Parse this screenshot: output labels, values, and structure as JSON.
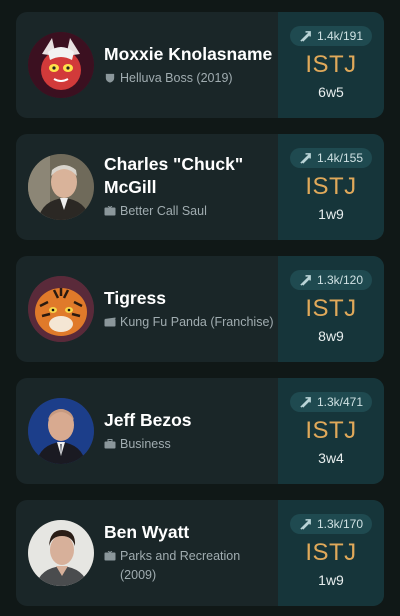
{
  "profiles": [
    {
      "name": "Moxxie Knolasname",
      "source": "Helluva Boss (2019)",
      "source_icon": "tv-shield-icon",
      "votes": "1.4k/191",
      "type": "ISTJ",
      "wing": "6w5"
    },
    {
      "name": "Charles \"Chuck\" McGill",
      "source": "Better Call Saul",
      "source_icon": "tv-icon",
      "votes": "1.4k/155",
      "type": "ISTJ",
      "wing": "1w9"
    },
    {
      "name": "Tigress",
      "source": "Kung Fu Panda (Franchise)",
      "source_icon": "film-icon",
      "votes": "1.3k/120",
      "type": "ISTJ",
      "wing": "8w9"
    },
    {
      "name": "Jeff Bezos",
      "source": "Business",
      "source_icon": "briefcase-icon",
      "votes": "1.3k/471",
      "type": "ISTJ",
      "wing": "3w4"
    },
    {
      "name": "Ben Wyatt",
      "source": "Parks and Recreation (2009)",
      "source_icon": "tv-icon",
      "votes": "1.3k/170",
      "type": "ISTJ",
      "wing": "1w9"
    }
  ],
  "colors": {
    "background": "#101817",
    "card": "#1a2628",
    "panel": "#16353a",
    "type_accent": "#e0a95a"
  }
}
